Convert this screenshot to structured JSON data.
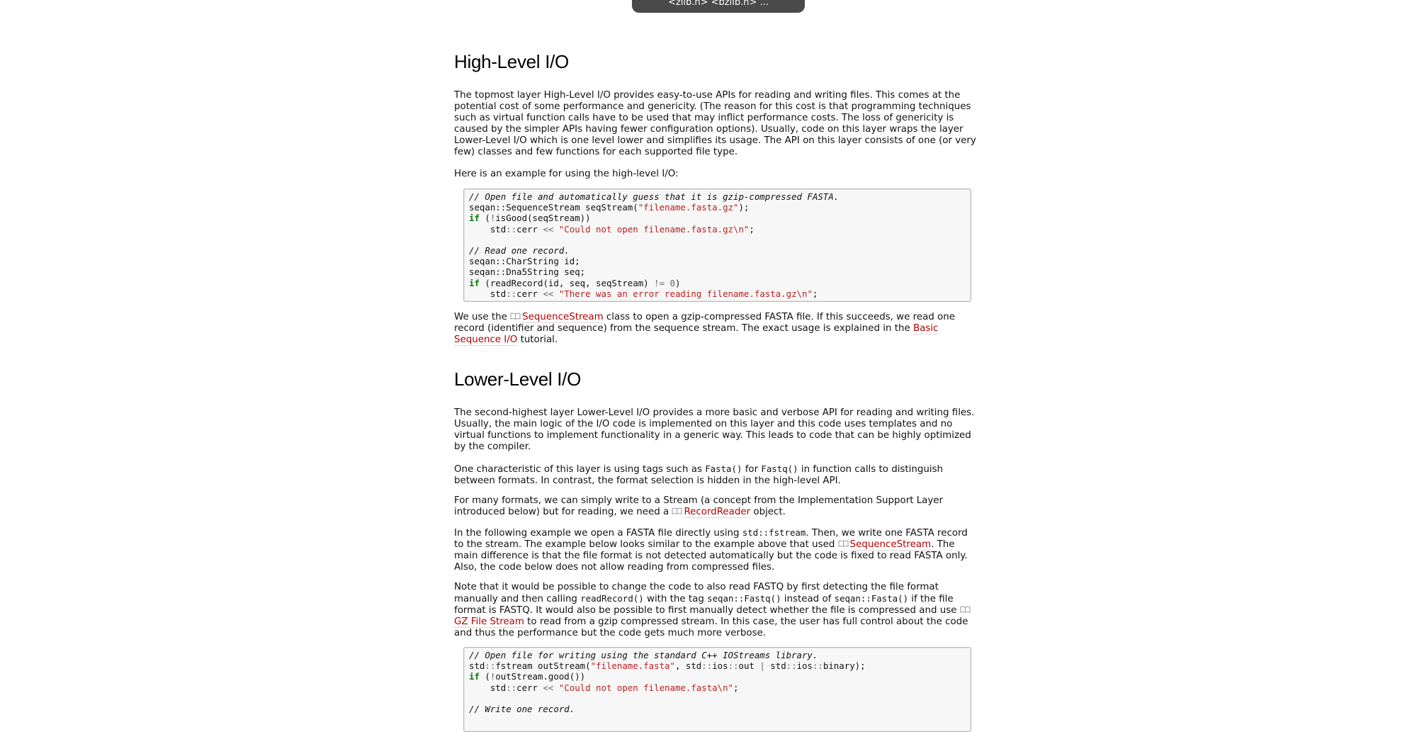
{
  "top_bar": {
    "text": "<zlib.h> <bzlib.h> ..."
  },
  "high_level": {
    "title": "High-Level I/O",
    "intro": "The topmost layer High-Level I/O provides easy-to-use APIs for reading and writing files. This comes at the potential cost of some performance and genericity. (The reason for this cost is that programming techniques such as virtual function calls have to be used that may inflict performance costs. The loss of genericity is caused by the simpler APIs having fewer configuration options). Usually, code on this layer wraps the layer Lower-Level I/O which is one level lower and simplifies its usage. The API on this layer consists of one (or very few) classes and few functions for each supported file type.",
    "example_intro": "Here is an example for using the high-level I/O:",
    "code": [
      "// Open file and automatically guess that it is gzip-compressed FASTA.",
      "seqan::SequenceStream seqStream(\"filename.fasta.gz\");",
      "if (!isGood(seqStream))",
      "    std::cerr << \"Could not open filename.fasta.gz\\n\";",
      "",
      "// Read one record.",
      "seqan::CharString id;",
      "seqan::Dna5String seq;",
      "if (readRecord(id, seq, seqStream) != 0)",
      "    std::cerr << \"There was an error reading filename.fasta.gz\\n\";"
    ],
    "after": {
      "t1": "We use the ",
      "link1": "SequenceStream",
      "t2": " class to open a gzip-compressed FASTA file. If this succeeds, we read one record (identifier and sequence) from the sequence stream. The exact usage is explained in the ",
      "link2": "Basic Sequence I/O",
      "t3": " tutorial."
    }
  },
  "lower_level": {
    "title": "Lower-Level I/O",
    "p1": "The second-highest layer Lower-Level I/O provides a more basic and verbose API for reading and writing files. Usually, the main logic of the I/O code is implemented on this layer and this code uses templates and no virtual functions to implement functionality in a generic way. This leads to code that can be highly optimized by the compiler.",
    "p2": {
      "t1": "One characteristic of this layer is using tags such as ",
      "c1": "Fasta()",
      "t2": " for ",
      "c2": "Fastq()",
      "t3": " in function calls to distinguish between formats. In contrast, the format selection is hidden in the high-level API."
    },
    "p3": {
      "t1": "For many formats, we can simply write to a Stream (a concept from the Implementation Support Layer introduced below) but for reading, we need a ",
      "link1": "RecordReader",
      "t2": " object."
    },
    "p4": {
      "t1": "In the following example we open a FASTA file directly using ",
      "c1": "std::fstream",
      "t2": ". Then, we write one FASTA record to the stream. The example below looks similar to the example above that used ",
      "link1": "SequenceStream",
      "t3": ". The main difference is that the file format is not detected automatically but the code is fixed to read FASTA only. Also, the code below does not allow reading from compressed files."
    },
    "p5": {
      "t1": "Note that it would be possible to change the code to also read FASTQ by first detecting the file format manually and then calling ",
      "c1": "readRecord()",
      "t2": " with the tag ",
      "c2": "seqan::Fastq()",
      "t3": " instead of ",
      "c3": "seqan::Fasta()",
      "t4": " if the file format is FASTQ. It would also be possible to first manually detect whether the file is compressed and use ",
      "link1": "GZ File Stream",
      "t5": " to read from a gzip compressed stream. In this case, the user has full control about the code and thus the performance but the code gets much more verbose."
    },
    "code": [
      "// Open file for writing using the standard C++ IOStreams library.",
      "std::fstream outStream(\"filename.fasta\", std::ios::out | std::ios::binary);",
      "if (!outStream.good())",
      "    std::cerr << \"Could not open filename.fasta\\n\";",
      "",
      "// Write one record."
    ]
  }
}
